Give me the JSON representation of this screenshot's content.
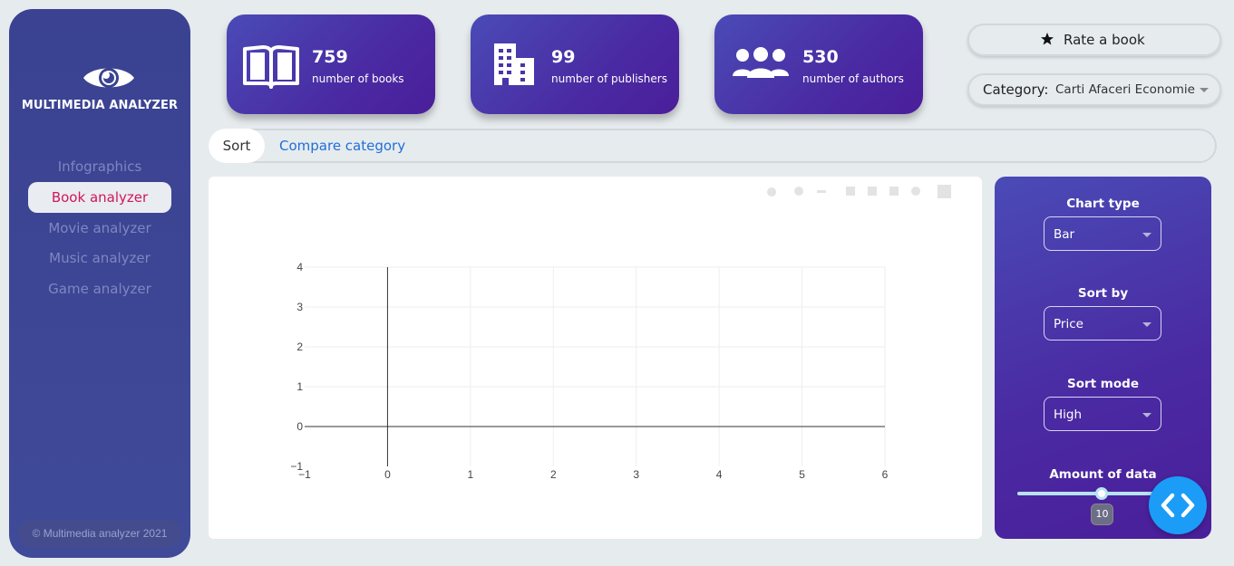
{
  "sidebar": {
    "brand": "MULTIMEDIA ANALYZER",
    "items": [
      {
        "label": "Infographics",
        "active": false
      },
      {
        "label": "Book analyzer",
        "active": true
      },
      {
        "label": "Movie analyzer",
        "active": false
      },
      {
        "label": "Music analyzer",
        "active": false
      },
      {
        "label": "Game analyzer",
        "active": false
      }
    ],
    "copyright": "© Multimedia analyzer 2021"
  },
  "stats": [
    {
      "icon": "book-open-icon",
      "value": "759",
      "label": "number of books"
    },
    {
      "icon": "building-icon",
      "value": "99",
      "label": "number of publishers"
    },
    {
      "icon": "users-icon",
      "value": "530",
      "label": "number of authors"
    }
  ],
  "header": {
    "rate_label": "Rate a book",
    "category_label": "Category:",
    "category_value": "Carti Afaceri Economie"
  },
  "tabs": [
    {
      "label": "Sort",
      "active": true
    },
    {
      "label": "Compare category",
      "active": false
    }
  ],
  "controls": {
    "chart_type": {
      "title": "Chart type",
      "value": "Bar"
    },
    "sort_by": {
      "title": "Sort by",
      "value": "Price"
    },
    "sort_mode": {
      "title": "Sort mode",
      "value": "High"
    },
    "amount": {
      "title": "Amount of data",
      "value": "10"
    }
  },
  "colors": {
    "sidebar": "#3a4291",
    "active_nav_text": "#d01856",
    "tab_link": "#1f6fd8",
    "card_gradient_start": "#4a4bb6",
    "card_gradient_end": "#4a1e9a",
    "fab": "#1b9cf7"
  },
  "chart_data": {
    "type": "bar",
    "series": [],
    "xlim": [
      -1,
      6
    ],
    "ylim": [
      -1,
      4
    ],
    "x_ticks": [
      "−1",
      "0",
      "1",
      "2",
      "3",
      "4",
      "5",
      "6"
    ],
    "y_ticks": [
      "−1",
      "0",
      "1",
      "2",
      "3",
      "4"
    ],
    "grid": true,
    "title": "",
    "xlabel": "",
    "ylabel": ""
  }
}
